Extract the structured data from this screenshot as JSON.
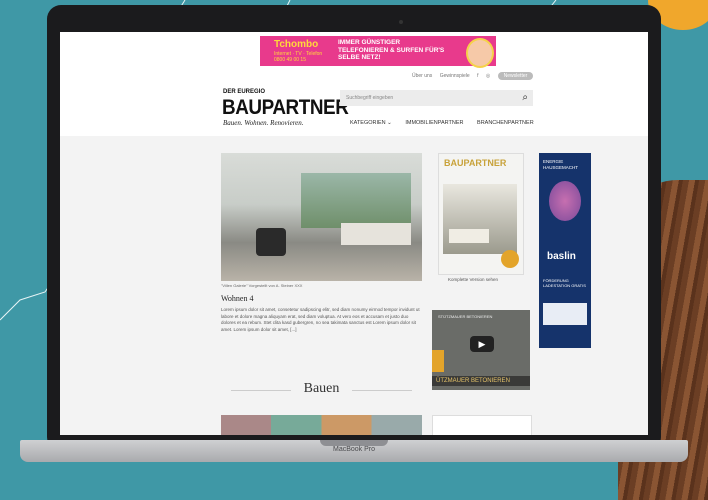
{
  "ad": {
    "brand": "Tchombo",
    "tagline": "Internet · TV · Telefon",
    "phone": "0800 49 00 15",
    "slogan": "IMMER GÜNSTIGER TELEFONIEREN & SURFEN FÜR'S SELBE NETZ!"
  },
  "header": {
    "toplinks": [
      "Über uns",
      "Gewinnspiele",
      "f",
      "◎"
    ],
    "newsletter": "Newsletter",
    "logo_small": "DER EUREGIO",
    "logo_big": "BAUPARTNER",
    "logo_sub": "Bauen. Wohnen. Renovieren.",
    "search_placeholder": "Suchbegriff eingeben",
    "nav": [
      "KATEGORIEN ⌄",
      "IMMOBILIENPARTNER",
      "BRANCHENPARTNER"
    ]
  },
  "article": {
    "caption": "\"Villen Galerie\" Vorgestellt von A. Steiner XXX",
    "title": "Wohnen 4",
    "body": "Lorem ipsum dolor sit amet, consetetur sadipscing elitr, sed diam nonumy eirmod tempor invidunt ut labore et dolore magna aliquyam erat, sed diam voluptua. At vero eos et accusam et justo duo dolores et ea rebum. Stet clita kasd gubergren, no sea takimata sanctus est Lorem ipsum dolor sit amet. Lorem ipsum dolor sit amet, [...]"
  },
  "magazine": {
    "cover_title": "BAUPARTNER",
    "caption": "Komplette Version sehen"
  },
  "video": {
    "channel": "STÜTZMAUER BETONIEREN",
    "title": "ÜTZMAUER BETONIEREN"
  },
  "sidead": {
    "line1": "ENERGIE HAUSGEMACHT",
    "logo": "baslin",
    "line2": "FÖRDERUNG LADESTATION GRATIS"
  },
  "section_heading": "Bauen",
  "device_label": "MacBook Pro",
  "colors": {
    "background": "#3f98a6",
    "ad_pink": "#e83a8c",
    "side_ad_blue": "#15336b"
  }
}
